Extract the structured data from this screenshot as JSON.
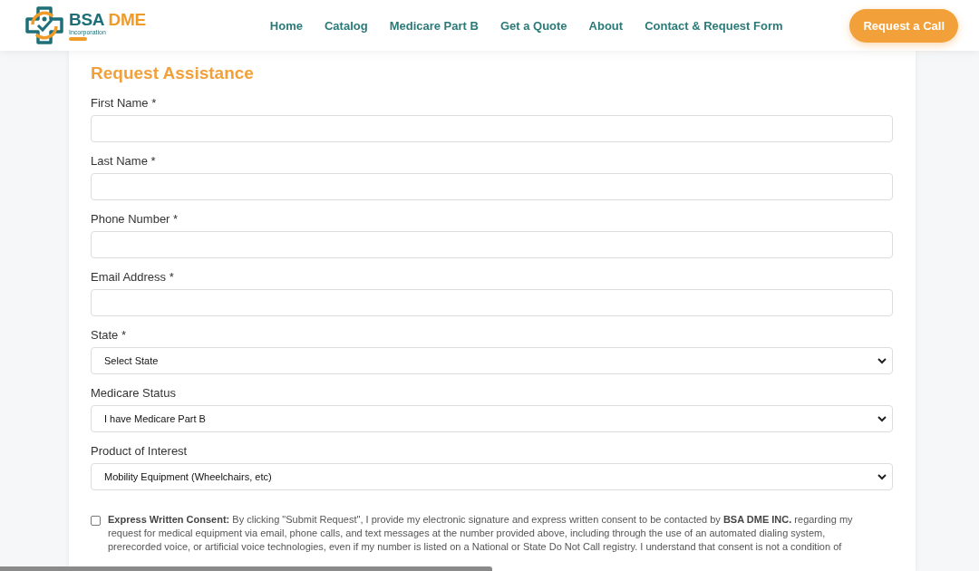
{
  "header": {
    "logo": {
      "name_1": "BSA",
      "name_2": "DME",
      "tagline": "Incorporation"
    },
    "nav": [
      {
        "label": "Home"
      },
      {
        "label": "Catalog"
      },
      {
        "label": "Medicare Part B"
      },
      {
        "label": "Get a Quote"
      },
      {
        "label": "About"
      },
      {
        "label": "Contact & Request Form"
      }
    ],
    "cta": "Request a Call"
  },
  "form": {
    "title": "Request Assistance",
    "fields": [
      {
        "kind": "text",
        "label": "First Name *"
      },
      {
        "kind": "text",
        "label": "Last Name *"
      },
      {
        "kind": "text",
        "label": "Phone Number *"
      },
      {
        "kind": "text",
        "label": "Email Address *"
      },
      {
        "kind": "select",
        "label": "State *",
        "value": "Select State"
      },
      {
        "kind": "select",
        "label": "Medicare Status",
        "value": "I have Medicare Part B"
      },
      {
        "kind": "select",
        "label": "Product of Interest",
        "value": "Mobility Equipment (Wheelchairs, etc)"
      }
    ],
    "consent": {
      "checked": false,
      "text": "**Express Written Consent:** By clicking \"Submit Request\", I provide my electronic signature and express written consent to be contacted by **BSA DME INC.** regarding my request for medical equipment via email, phone calls, and text messages at the number provided above, including through the use of an automated dialing system, prerecorded voice, or artificial voice technologies, even if my number is listed on a National or State Do Not Call registry. I understand that consent is not a condition of"
    }
  }
}
